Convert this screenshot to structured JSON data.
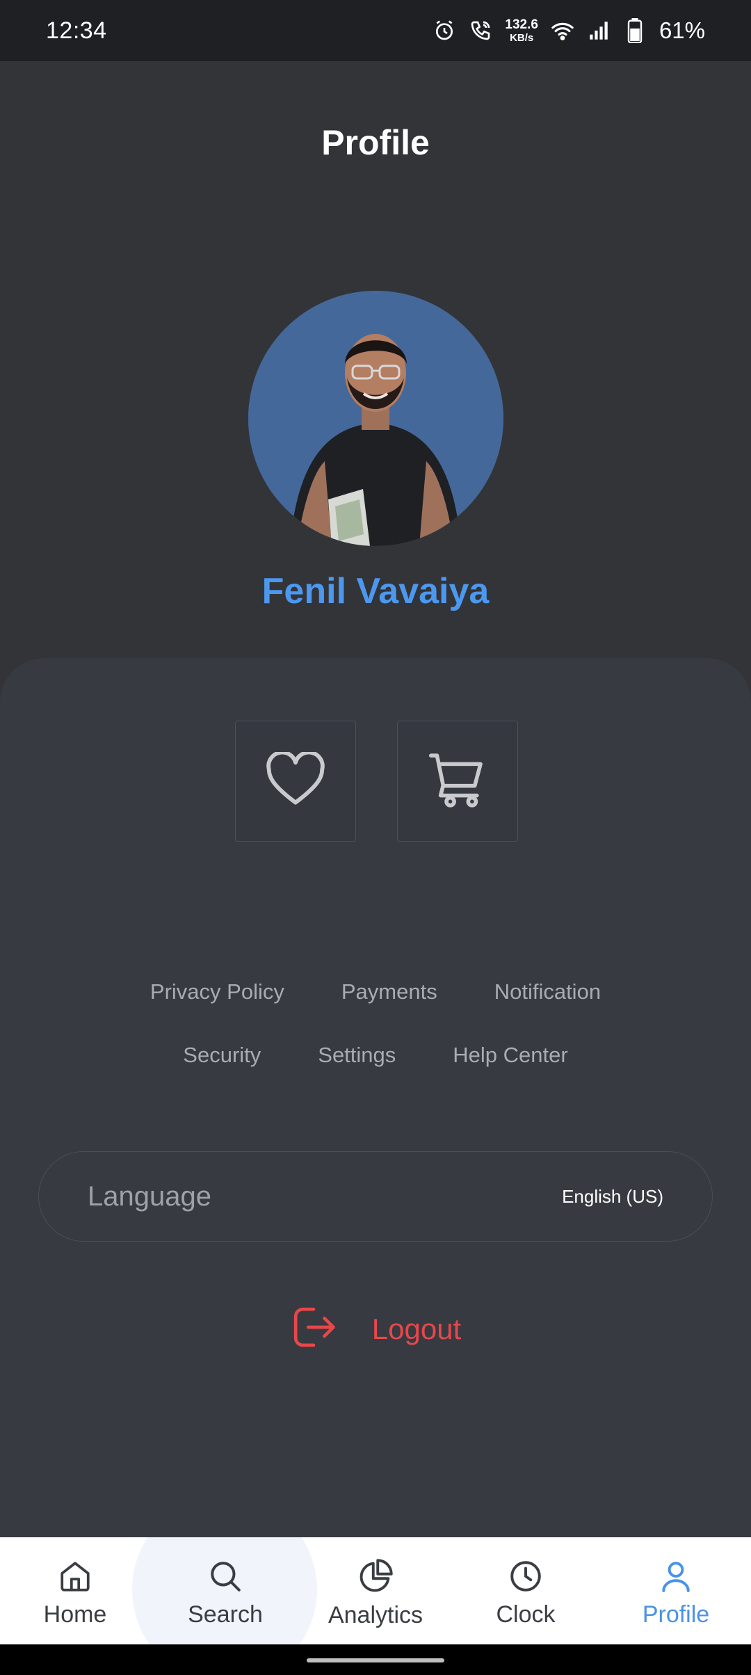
{
  "status_bar": {
    "time": "12:34",
    "net_speed_value": "132.6",
    "net_speed_unit": "KB/s",
    "battery_percent": "61%",
    "icons": [
      "alarm-icon",
      "wifi-call-icon",
      "wifi-icon",
      "signal-icon",
      "battery-icon"
    ]
  },
  "header": {
    "title": "Profile"
  },
  "profile": {
    "name": "Fenil Vavaiya",
    "avatar_bg": "#44689a",
    "name_color": "#4c98ee"
  },
  "quick_actions": [
    {
      "icon": "heart-icon"
    },
    {
      "icon": "cart-icon"
    }
  ],
  "links": {
    "row1": [
      "Privacy Policy",
      "Payments",
      "Notification"
    ],
    "row2": [
      "Security",
      "Settings",
      "Help Center"
    ]
  },
  "language": {
    "label": "Language",
    "value": "English (US)"
  },
  "logout": {
    "label": "Logout",
    "color": "#e8474a"
  },
  "bottom_nav": {
    "items": [
      {
        "label": "Home",
        "icon": "home-icon"
      },
      {
        "label": "Search",
        "icon": "search-icon"
      },
      {
        "label": "Analytics",
        "icon": "pie-chart-icon"
      },
      {
        "label": "Clock",
        "icon": "clock-icon"
      },
      {
        "label": "Profile",
        "icon": "person-icon"
      }
    ],
    "active": "Profile",
    "active_color": "#4a93e6"
  }
}
